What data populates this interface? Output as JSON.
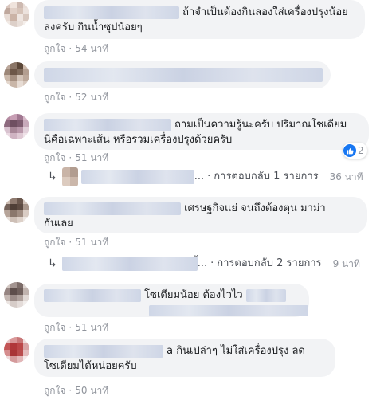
{
  "comments": [
    {
      "text_lines": [
        "ถ้าจำเป็นต้องกินลองใส่เครื่องปรุงน้อย",
        "ลงครับ กินน้ำซุปน้อยๆ"
      ],
      "like_label": "ถูกใจ",
      "time": "54 นาที"
    },
    {
      "text_lines": [],
      "like_label": "ถูกใจ",
      "time": "52 นาที"
    },
    {
      "text_lines": [
        "ถามเป็นความรู้นะครับ ปริมาณโซเดียม",
        "นี่คือเฉพาะเส้น หรือรวมเครื่องปรุงด้วยครับ"
      ],
      "like_label": "ถูกใจ",
      "time": "51 นาที",
      "reaction_count": "2",
      "reply_ellipsis": "...",
      "reply_label": "การตอบกลับ 1 รายการ",
      "reply_time": "36 นาที"
    },
    {
      "text_lines": [
        "เศรษฐกิจแย่ จนถึงต้องตุน มาม่า",
        "กันเลย"
      ],
      "like_label": "ถูกใจ",
      "time": "51 นาที",
      "reply_ellipsis": "้...",
      "reply_label": "การตอบกลับ 2 รายการ",
      "reply_time": "9 นาที"
    },
    {
      "text_lines": [
        "โซเดียมน้อย ต้องไวไว"
      ],
      "like_label": "ถูกใจ",
      "time": "51 นาที"
    },
    {
      "text_lines": [
        "a กินเปล่าๆ ไม่ใส่เครื่องปรุง ลด",
        "โซเดียมได้หน่อยครับ"
      ],
      "like_label": "ถูกใจ",
      "time": "50 นาที"
    }
  ],
  "separator": "·",
  "colors": {
    "bubble": "#f2f3f5",
    "meta": "#90949c",
    "like_blue": "#1877f2"
  }
}
